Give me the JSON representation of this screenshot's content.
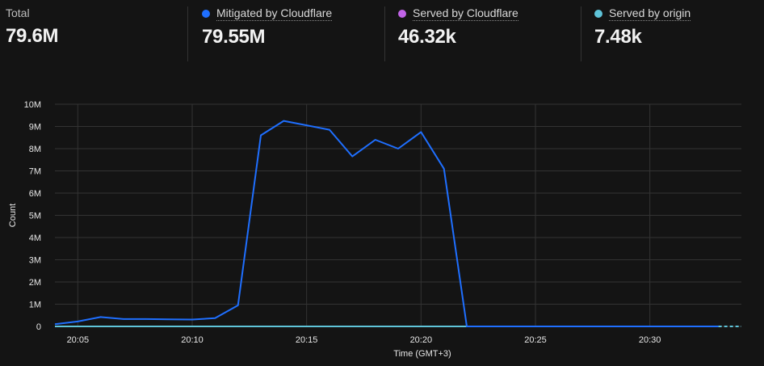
{
  "stats": {
    "total": {
      "label": "Total",
      "value": "79.6M"
    },
    "mitigated": {
      "label": "Mitigated by Cloudflare",
      "value": "79.55M",
      "color": "#1f6fff"
    },
    "served_cf": {
      "label": "Served by Cloudflare",
      "value": "46.32k",
      "color": "#c264e8"
    },
    "served_origin": {
      "label": "Served by origin",
      "value": "7.48k",
      "color": "#5fc4d9"
    }
  },
  "chart_data": {
    "type": "line",
    "xlabel": "Time (GMT+3)",
    "ylabel": "Count",
    "ylim": [
      0,
      10000000
    ],
    "x_range": [
      "20:04",
      "20:34"
    ],
    "y_ticks": [
      {
        "value": 0,
        "label": "0"
      },
      {
        "value": 1000000,
        "label": "1M"
      },
      {
        "value": 2000000,
        "label": "2M"
      },
      {
        "value": 3000000,
        "label": "3M"
      },
      {
        "value": 4000000,
        "label": "4M"
      },
      {
        "value": 5000000,
        "label": "5M"
      },
      {
        "value": 6000000,
        "label": "6M"
      },
      {
        "value": 7000000,
        "label": "7M"
      },
      {
        "value": 8000000,
        "label": "8M"
      },
      {
        "value": 9000000,
        "label": "9M"
      },
      {
        "value": 10000000,
        "label": "10M"
      }
    ],
    "x_ticks": [
      "20:05",
      "20:10",
      "20:15",
      "20:20",
      "20:25",
      "20:30"
    ],
    "grid": true,
    "series": [
      {
        "name": "Mitigated by Cloudflare",
        "color": "#1f6fff",
        "points": [
          [
            "20:04",
            100000
          ],
          [
            "20:05",
            220000
          ],
          [
            "20:06",
            420000
          ],
          [
            "20:07",
            330000
          ],
          [
            "20:08",
            330000
          ],
          [
            "20:09",
            320000
          ],
          [
            "20:10",
            310000
          ],
          [
            "20:11",
            370000
          ],
          [
            "20:12",
            950000
          ],
          [
            "20:13",
            8600000
          ],
          [
            "20:14",
            9250000
          ],
          [
            "20:15",
            9050000
          ],
          [
            "20:16",
            8850000
          ],
          [
            "20:17",
            7650000
          ],
          [
            "20:18",
            8400000
          ],
          [
            "20:19",
            8000000
          ],
          [
            "20:20",
            8750000
          ],
          [
            "20:21",
            7100000
          ],
          [
            "20:22",
            0
          ],
          [
            "20:23",
            0
          ],
          [
            "20:24",
            0
          ],
          [
            "20:25",
            0
          ],
          [
            "20:26",
            0
          ],
          [
            "20:27",
            0
          ],
          [
            "20:28",
            0
          ],
          [
            "20:29",
            0
          ],
          [
            "20:30",
            0
          ],
          [
            "20:31",
            0
          ],
          [
            "20:32",
            0
          ],
          [
            "20:33",
            0
          ]
        ]
      },
      {
        "name": "Served by origin",
        "color": "#5fc4d9",
        "points": [
          [
            "20:04",
            0
          ],
          [
            "20:10",
            0
          ],
          [
            "20:15",
            0
          ],
          [
            "20:20",
            0
          ],
          [
            "20:25",
            0
          ],
          [
            "20:30",
            0
          ],
          [
            "20:33",
            0
          ]
        ]
      }
    ]
  }
}
